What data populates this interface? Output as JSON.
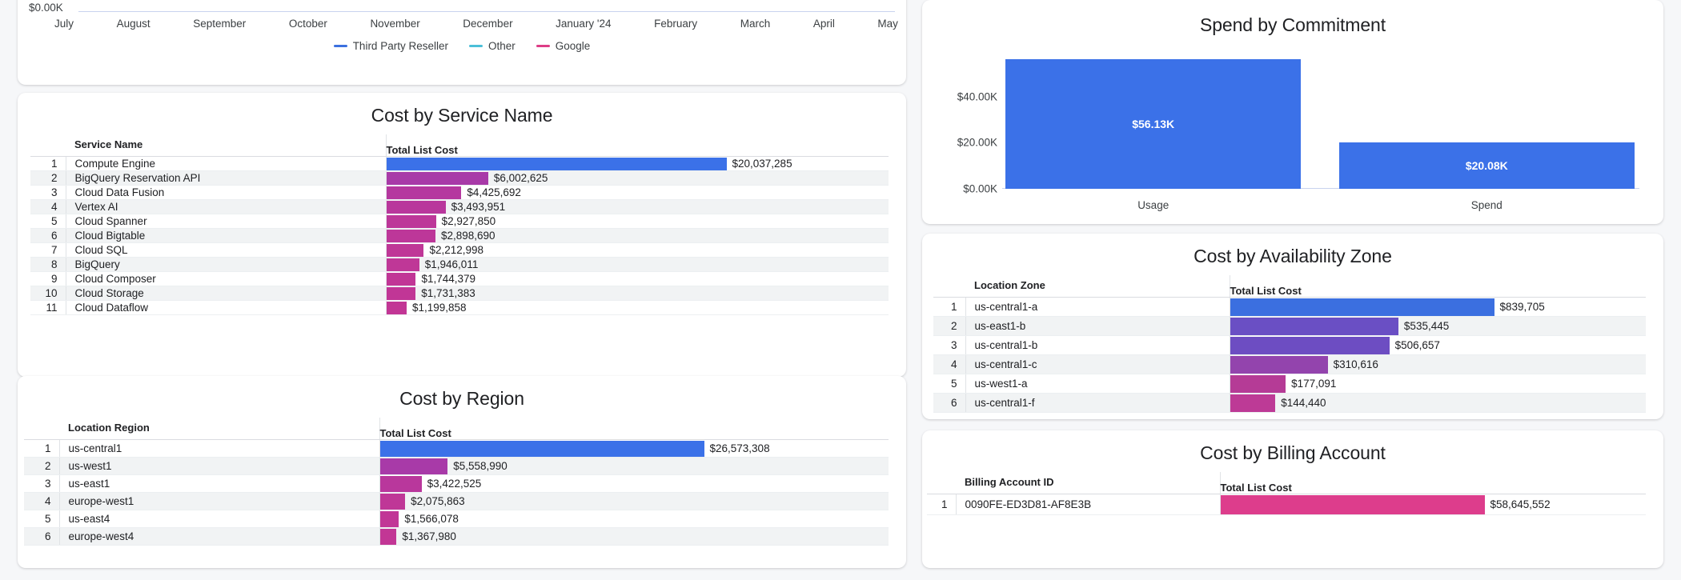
{
  "colors": {
    "blue": "#3b71e8",
    "cyan": "#4bbfd8",
    "pink": "#dd3d86",
    "magenta": "#bd3a96",
    "axis": "#c9d3ef"
  },
  "trend": {
    "y_axis_label": "$0.00K",
    "months": [
      "July",
      "August",
      "September",
      "October",
      "November",
      "December",
      "January '24",
      "February",
      "March",
      "April",
      "May"
    ],
    "legend": [
      {
        "label": "Third Party Reseller",
        "color": "#3c70df"
      },
      {
        "label": "Other",
        "color": "#4bbfd8"
      },
      {
        "label": "Google",
        "color": "#dd3d86"
      }
    ]
  },
  "service": {
    "title": "Cost by Service Name",
    "columns": [
      "Service Name",
      "Total List Cost"
    ],
    "rows": [
      {
        "idx": "1",
        "name": "Compute Engine",
        "value": "$20,037,285",
        "num": 20037285,
        "color": "#3b71e8"
      },
      {
        "idx": "2",
        "name": "BigQuery Reservation API",
        "value": "$6,002,625",
        "num": 6002625,
        "color": "#a83aa8"
      },
      {
        "idx": "3",
        "name": "Cloud Data Fusion",
        "value": "$4,425,692",
        "num": 4425692,
        "color": "#b5389f"
      },
      {
        "idx": "4",
        "name": "Vertex AI",
        "value": "$3,493,951",
        "num": 3493951,
        "color": "#b9379c"
      },
      {
        "idx": "5",
        "name": "Cloud Spanner",
        "value": "$2,927,850",
        "num": 2927850,
        "color": "#bd3799"
      },
      {
        "idx": "6",
        "name": "Cloud Bigtable",
        "value": "$2,898,690",
        "num": 2898690,
        "color": "#bd3799"
      },
      {
        "idx": "7",
        "name": "Cloud SQL",
        "value": "$2,212,998",
        "num": 2212998,
        "color": "#bf3797"
      },
      {
        "idx": "8",
        "name": "BigQuery",
        "value": "$1,946,011",
        "num": 1946011,
        "color": "#bf3797"
      },
      {
        "idx": "9",
        "name": "Cloud Composer",
        "value": "$1,744,379",
        "num": 1744379,
        "color": "#c13696"
      },
      {
        "idx": "10",
        "name": "Cloud Storage",
        "value": "$1,731,383",
        "num": 1731383,
        "color": "#c13696"
      },
      {
        "idx": "11",
        "name": "Cloud Dataflow",
        "value": "$1,199,858",
        "num": 1199858,
        "color": "#c23695"
      }
    ]
  },
  "region": {
    "title": "Cost by Region",
    "columns": [
      "Location Region",
      "Total List Cost"
    ],
    "rows": [
      {
        "idx": "1",
        "name": "us-central1",
        "value": "$26,573,308",
        "num": 26573308,
        "color": "#3b71e8"
      },
      {
        "idx": "2",
        "name": "us-west1",
        "value": "$5,558,990",
        "num": 5558990,
        "color": "#a83aa8"
      },
      {
        "idx": "3",
        "name": "us-east1",
        "value": "$3,422,525",
        "num": 3422525,
        "color": "#b9379c"
      },
      {
        "idx": "4",
        "name": "europe-west1",
        "value": "$2,075,863",
        "num": 2075863,
        "color": "#bf3797"
      },
      {
        "idx": "5",
        "name": "us-east4",
        "value": "$1,566,078",
        "num": 1566078,
        "color": "#c13696"
      },
      {
        "idx": "6",
        "name": "europe-west4",
        "value": "$1,367,980",
        "num": 1367980,
        "color": "#c23695"
      }
    ]
  },
  "commitment": {
    "title": "Spend by Commitment",
    "y_ticks": [
      "$40.00K",
      "$20.00K",
      "$0.00K"
    ],
    "bars": [
      {
        "label": "Usage",
        "value_label": "$56.13K",
        "num": 56.13
      },
      {
        "label": "Spend",
        "value_label": "$20.08K",
        "num": 20.08
      }
    ]
  },
  "zone": {
    "title": "Cost by Availability Zone",
    "columns": [
      "Location Zone",
      "Total List Cost"
    ],
    "rows": [
      {
        "idx": "1",
        "name": "us-central1-a",
        "value": "$839,705",
        "num": 839705,
        "color": "#3b6fe0"
      },
      {
        "idx": "2",
        "name": "us-east1-b",
        "value": "$535,445",
        "num": 535445,
        "color": "#6a4fc4"
      },
      {
        "idx": "3",
        "name": "us-central1-b",
        "value": "$506,657",
        "num": 506657,
        "color": "#6d4dc2"
      },
      {
        "idx": "4",
        "name": "us-central1-c",
        "value": "$310,616",
        "num": 310616,
        "color": "#9344ad"
      },
      {
        "idx": "5",
        "name": "us-west1-a",
        "value": "$177,091",
        "num": 177091,
        "color": "#b53b96"
      },
      {
        "idx": "6",
        "name": "us-central1-f",
        "value": "$144,440",
        "num": 144440,
        "color": "#bd3a96"
      }
    ]
  },
  "billing": {
    "title": "Cost by Billing Account",
    "columns": [
      "Billing Account ID",
      "Total List Cost"
    ],
    "rows": [
      {
        "idx": "1",
        "name": "0090FE-ED3D81-AF8E3B",
        "value": "$58,645,552",
        "num": 58645552,
        "color": "#dd3d8c"
      }
    ]
  },
  "chart_data": [
    {
      "type": "line",
      "title": "",
      "xlabel": "",
      "ylabel": "",
      "x": [
        "July",
        "August",
        "September",
        "October",
        "November",
        "December",
        "January '24",
        "February",
        "March",
        "April",
        "May"
      ],
      "ytick_labels": [
        "$0.00K"
      ],
      "series": [
        {
          "name": "Third Party Reseller",
          "color": "#3c70df"
        },
        {
          "name": "Other",
          "color": "#4bbfd8"
        },
        {
          "name": "Google",
          "color": "#dd3d86"
        }
      ],
      "legend_position": "bottom",
      "grid": false,
      "note": "chart plot area clipped above top of screenshot; only axis, tick labels and legend visible"
    },
    {
      "type": "bar",
      "title": "Spend by Commitment",
      "categories": [
        "Usage",
        "Spend"
      ],
      "values": [
        56.13,
        20.08
      ],
      "value_labels": [
        "$56.13K",
        "$20.08K"
      ],
      "ylim": [
        0,
        60
      ],
      "ytick_labels": [
        "$0.00K",
        "$20.00K",
        "$40.00K"
      ],
      "xlabel": "",
      "ylabel": "",
      "grid": false,
      "legend_position": "none",
      "bar_color": "#3b71e8"
    },
    {
      "type": "bar",
      "title": "Cost by Service Name",
      "orientation": "horizontal",
      "categories": [
        "Compute Engine",
        "BigQuery Reservation API",
        "Cloud Data Fusion",
        "Vertex AI",
        "Cloud Spanner",
        "Cloud Bigtable",
        "Cloud SQL",
        "BigQuery",
        "Cloud Composer",
        "Cloud Storage",
        "Cloud Dataflow"
      ],
      "values": [
        20037285,
        6002625,
        4425692,
        3493951,
        2927850,
        2898690,
        2212998,
        1946011,
        1744379,
        1731383,
        1199858
      ],
      "ylabel": "Total List Cost"
    },
    {
      "type": "bar",
      "title": "Cost by Region",
      "orientation": "horizontal",
      "categories": [
        "us-central1",
        "us-west1",
        "us-east1",
        "europe-west1",
        "us-east4",
        "europe-west4"
      ],
      "values": [
        26573308,
        5558990,
        3422525,
        2075863,
        1566078,
        1367980
      ],
      "ylabel": "Total List Cost"
    },
    {
      "type": "bar",
      "title": "Cost by Availability Zone",
      "orientation": "horizontal",
      "categories": [
        "us-central1-a",
        "us-east1-b",
        "us-central1-b",
        "us-central1-c",
        "us-west1-a",
        "us-central1-f"
      ],
      "values": [
        839705,
        535445,
        506657,
        310616,
        177091,
        144440
      ],
      "ylabel": "Total List Cost"
    },
    {
      "type": "bar",
      "title": "Cost by Billing Account",
      "orientation": "horizontal",
      "categories": [
        "0090FE-ED3D81-AF8E3B"
      ],
      "values": [
        58645552
      ],
      "ylabel": "Total List Cost"
    }
  ]
}
